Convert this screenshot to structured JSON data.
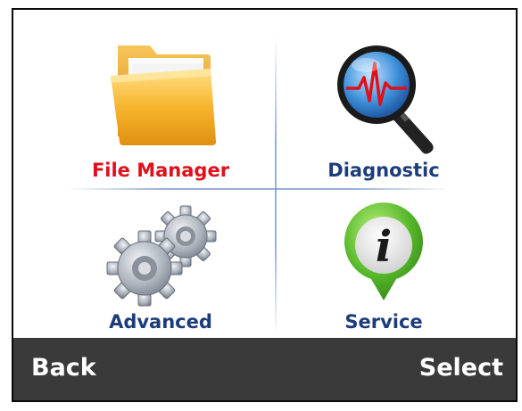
{
  "menu": {
    "items": [
      {
        "label": "File Manager",
        "icon": "folder-icon",
        "selected": true
      },
      {
        "label": "Diagnostic",
        "icon": "magnifier-waveform-icon",
        "selected": false
      },
      {
        "label": "Advanced",
        "icon": "gears-icon",
        "selected": false
      },
      {
        "label": "Service",
        "icon": "info-pin-icon",
        "selected": false
      }
    ]
  },
  "softkeys": {
    "left": "Back",
    "right": "Select"
  },
  "colors": {
    "selected_label": "#e0101a",
    "label": "#1d3d7a",
    "softbar": "#3a3a3a",
    "softkey_text": "#ffffff"
  }
}
